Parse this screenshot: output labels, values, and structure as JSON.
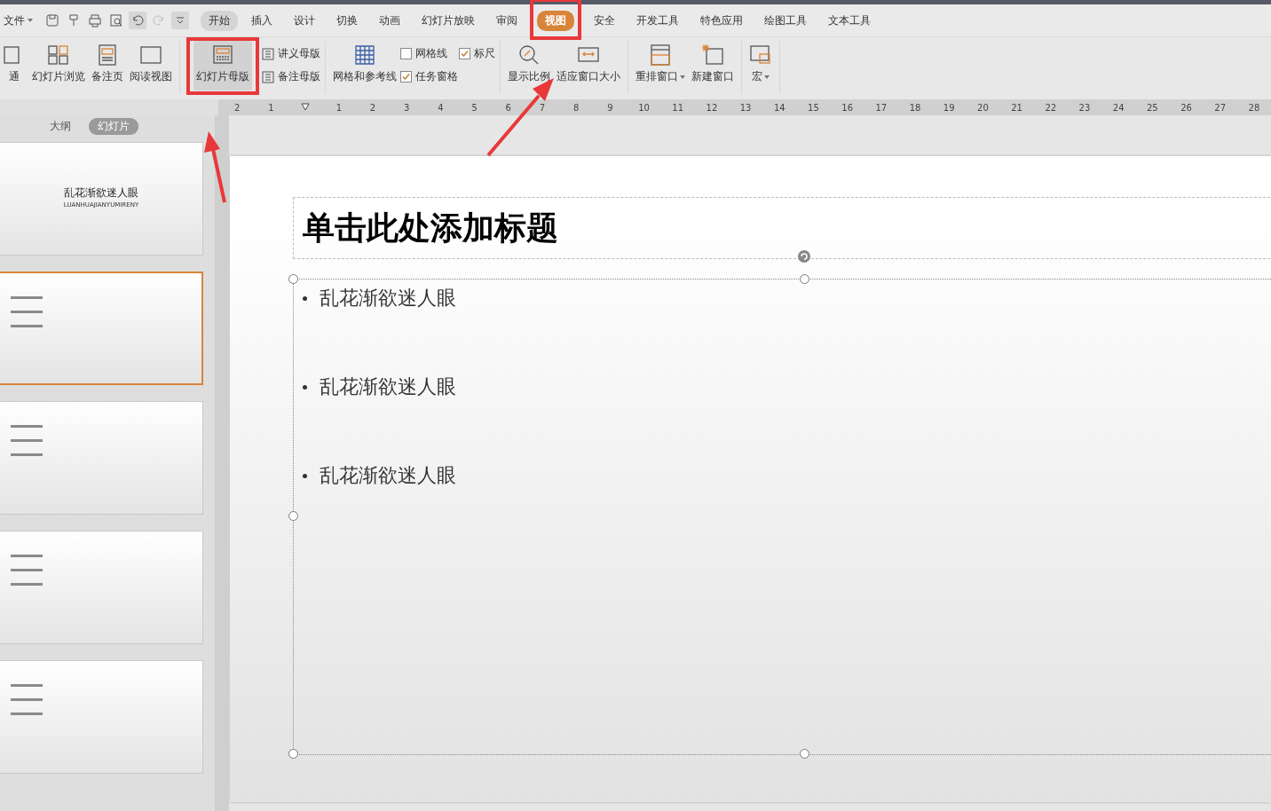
{
  "file_menu": {
    "label": "文件",
    "dropdown": true
  },
  "menu_tabs": [
    {
      "label": "开始",
      "selected": false,
      "hovered": true,
      "annotated": false
    },
    {
      "label": "插入",
      "selected": false,
      "hovered": false,
      "annotated": false
    },
    {
      "label": "设计",
      "selected": false,
      "hovered": false,
      "annotated": false
    },
    {
      "label": "切换",
      "selected": false,
      "hovered": false,
      "annotated": false
    },
    {
      "label": "动画",
      "selected": false,
      "hovered": false,
      "annotated": false
    },
    {
      "label": "幻灯片放映",
      "selected": false,
      "hovered": false,
      "annotated": false
    },
    {
      "label": "审阅",
      "selected": false,
      "hovered": false,
      "annotated": false
    },
    {
      "label": "视图",
      "selected": true,
      "hovered": false,
      "annotated": true
    },
    {
      "label": "安全",
      "selected": false,
      "hovered": false,
      "annotated": false
    },
    {
      "label": "开发工具",
      "selected": false,
      "hovered": false,
      "annotated": false
    },
    {
      "label": "特色应用",
      "selected": false,
      "hovered": false,
      "annotated": false
    },
    {
      "label": "绘图工具",
      "selected": false,
      "hovered": false,
      "annotated": false
    },
    {
      "label": "文本工具",
      "selected": false,
      "hovered": false,
      "annotated": false
    }
  ],
  "ribbon": {
    "groups": [
      {
        "items": [
          {
            "kind": "large",
            "label": "通",
            "pressed": false,
            "dropdown": false,
            "annotated": false
          },
          {
            "kind": "large",
            "label": "幻灯片浏览",
            "pressed": false,
            "dropdown": false,
            "annotated": false
          },
          {
            "kind": "large",
            "label": "备注页",
            "pressed": false,
            "dropdown": false,
            "annotated": false
          },
          {
            "kind": "large",
            "label": "阅读视图",
            "pressed": false,
            "dropdown": false,
            "annotated": false
          }
        ]
      },
      {
        "items": [
          {
            "kind": "large",
            "label": "幻灯片母版",
            "pressed": true,
            "dropdown": false,
            "annotated": true
          },
          {
            "kind": "small",
            "label": "讲义母版"
          },
          {
            "kind": "small",
            "label": "备注母版"
          }
        ]
      },
      {
        "items": [
          {
            "kind": "large",
            "label": "网格和参考线",
            "pressed": false,
            "dropdown": false,
            "annotated": false
          },
          {
            "kind": "checkbox",
            "label": "网格线",
            "checked": false
          },
          {
            "kind": "checkbox",
            "label": "任务窗格",
            "checked": true
          },
          {
            "kind": "checkbox",
            "label": "标尺",
            "checked": true
          }
        ]
      },
      {
        "items": [
          {
            "kind": "large",
            "label": "显示比例",
            "pressed": false,
            "dropdown": false,
            "annotated": false
          },
          {
            "kind": "large",
            "label": "适应窗口大小",
            "pressed": false,
            "dropdown": false,
            "annotated": false
          }
        ]
      },
      {
        "items": [
          {
            "kind": "large",
            "label": "重排窗口",
            "pressed": false,
            "dropdown": true,
            "annotated": false
          },
          {
            "kind": "large",
            "label": "新建窗口",
            "pressed": false,
            "dropdown": false,
            "annotated": false
          }
        ]
      },
      {
        "items": [
          {
            "kind": "large",
            "label": "宏",
            "pressed": false,
            "dropdown": true,
            "annotated": false
          }
        ]
      }
    ]
  },
  "ruler": {
    "labels": [
      "2",
      "1",
      "1",
      "2",
      "3",
      "4",
      "5",
      "6",
      "7",
      "8",
      "9",
      "10",
      "11",
      "12",
      "13",
      "14",
      "15",
      "16",
      "17",
      "18",
      "19",
      "20",
      "21",
      "22",
      "23",
      "24",
      "25",
      "26",
      "27",
      "28"
    ]
  },
  "panel_tabs": [
    {
      "label": "大纲",
      "selected": false
    },
    {
      "label": "幻灯片",
      "selected": true
    }
  ],
  "thumbnails": [
    {
      "kind": "title",
      "title": "乱花渐欲迷人眼",
      "subtitle": "LUANHUAJIANYUMIRENY",
      "selected": false
    },
    {
      "kind": "bullets",
      "selected": true
    },
    {
      "kind": "bullets",
      "selected": false
    },
    {
      "kind": "bullets",
      "selected": false
    },
    {
      "kind": "bullets",
      "selected": false
    }
  ],
  "slide": {
    "title": "单击此处添加标题",
    "bullets": [
      "乱花渐欲迷人眼",
      "乱花渐欲迷人眼",
      "乱花渐欲迷人眼"
    ]
  }
}
